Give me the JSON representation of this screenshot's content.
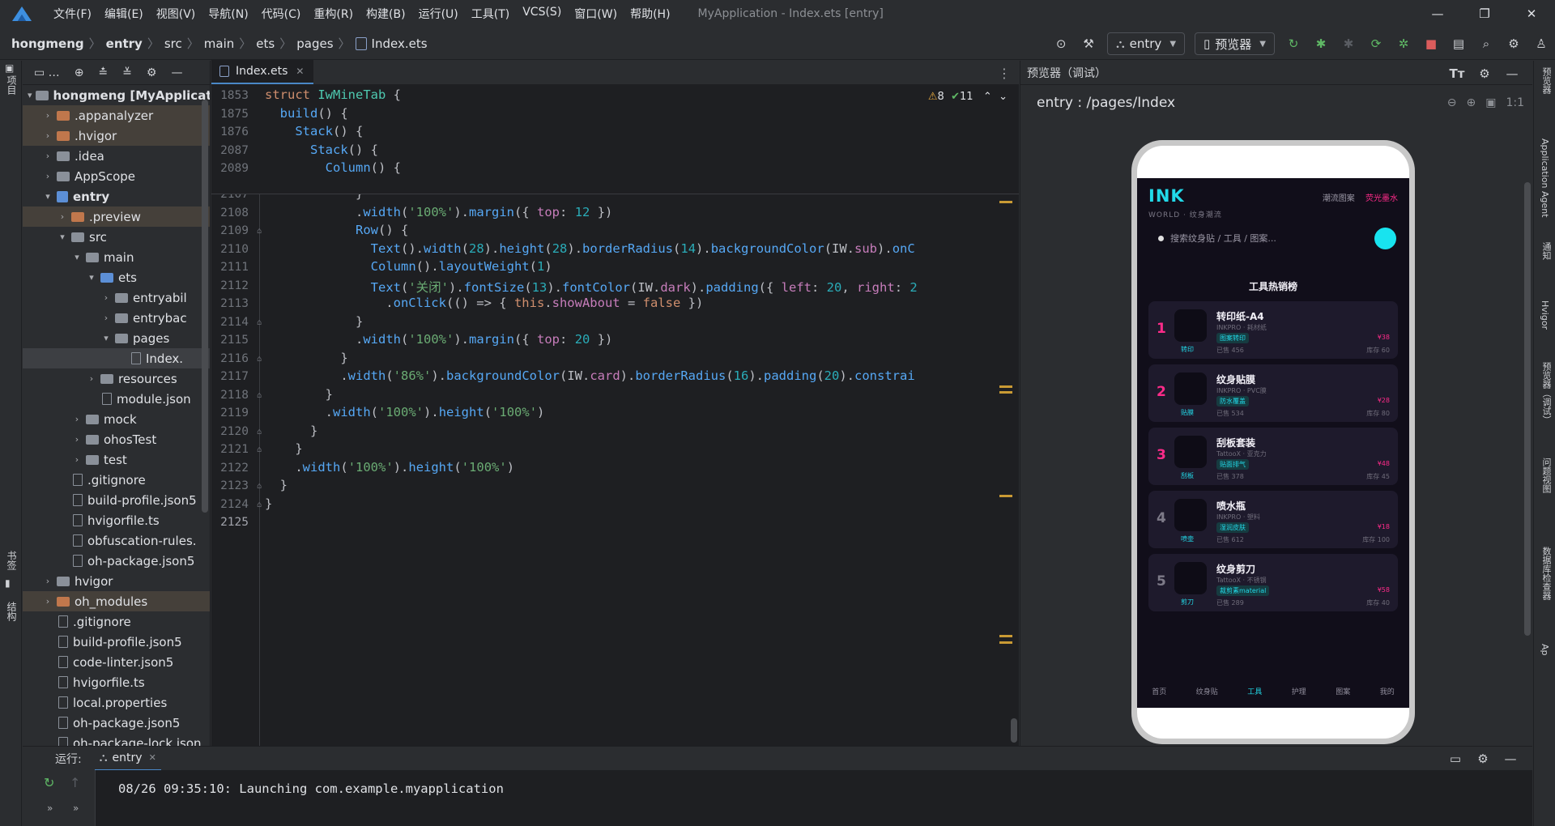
{
  "app": {
    "window_title": "MyApplication - Index.ets [entry]",
    "menu": [
      "文件(F)",
      "编辑(E)",
      "视图(V)",
      "导航(N)",
      "代码(C)",
      "重构(R)",
      "构建(B)",
      "运行(U)",
      "工具(T)",
      "VCS(S)",
      "窗口(W)",
      "帮助(H)"
    ]
  },
  "breadcrumb": [
    "hongmeng",
    "entry",
    "src",
    "main",
    "ets",
    "pages",
    "Index.ets"
  ],
  "toolbar": {
    "run_config": "entry",
    "previewer": "预览器"
  },
  "left_strip": {
    "project": "项目",
    "bookmarks": "书签",
    "structure": "结构"
  },
  "project_tree": [
    {
      "label": "hongmeng [MyApplicati",
      "indent": 0,
      "arrow": "▾",
      "icon": "folder",
      "bold": true
    },
    {
      "label": ".appanalyzer",
      "indent": 1,
      "arrow": "›",
      "icon": "orange",
      "sel": true
    },
    {
      "label": ".hvigor",
      "indent": 1,
      "arrow": "›",
      "icon": "orange",
      "sel": true
    },
    {
      "label": ".idea",
      "indent": 1,
      "arrow": "›",
      "icon": "folder"
    },
    {
      "label": "AppScope",
      "indent": 1,
      "arrow": "›",
      "icon": "folder"
    },
    {
      "label": "entry",
      "indent": 1,
      "arrow": "▾",
      "icon": "mod",
      "bold": true
    },
    {
      "label": ".preview",
      "indent": 2,
      "arrow": "›",
      "icon": "orange",
      "sel": true
    },
    {
      "label": "src",
      "indent": 2,
      "arrow": "▾",
      "icon": "folder"
    },
    {
      "label": "main",
      "indent": 3,
      "arrow": "▾",
      "icon": "folder"
    },
    {
      "label": "ets",
      "indent": 4,
      "arrow": "▾",
      "icon": "blue"
    },
    {
      "label": "entryabil",
      "indent": 5,
      "arrow": "›",
      "icon": "folder"
    },
    {
      "label": "entrybac",
      "indent": 5,
      "arrow": "›",
      "icon": "folder"
    },
    {
      "label": "pages",
      "indent": 5,
      "arrow": "▾",
      "icon": "folder"
    },
    {
      "label": "Index.",
      "indent": 6,
      "arrow": "",
      "icon": "file",
      "hl": true
    },
    {
      "label": "resources",
      "indent": 4,
      "arrow": "›",
      "icon": "folder"
    },
    {
      "label": "module.json",
      "indent": 4,
      "arrow": "",
      "icon": "file"
    },
    {
      "label": "mock",
      "indent": 3,
      "arrow": "›",
      "icon": "folder"
    },
    {
      "label": "ohosTest",
      "indent": 3,
      "arrow": "›",
      "icon": "folder"
    },
    {
      "label": "test",
      "indent": 3,
      "arrow": "›",
      "icon": "folder"
    },
    {
      "label": ".gitignore",
      "indent": 2,
      "arrow": "",
      "icon": "file"
    },
    {
      "label": "build-profile.json5",
      "indent": 2,
      "arrow": "",
      "icon": "file"
    },
    {
      "label": "hvigorfile.ts",
      "indent": 2,
      "arrow": "",
      "icon": "file"
    },
    {
      "label": "obfuscation-rules.",
      "indent": 2,
      "arrow": "",
      "icon": "file"
    },
    {
      "label": "oh-package.json5",
      "indent": 2,
      "arrow": "",
      "icon": "file"
    },
    {
      "label": "hvigor",
      "indent": 1,
      "arrow": "›",
      "icon": "folder"
    },
    {
      "label": "oh_modules",
      "indent": 1,
      "arrow": "›",
      "icon": "orange",
      "sel": true
    },
    {
      "label": ".gitignore",
      "indent": 1,
      "arrow": "",
      "icon": "file"
    },
    {
      "label": "build-profile.json5",
      "indent": 1,
      "arrow": "",
      "icon": "file"
    },
    {
      "label": "code-linter.json5",
      "indent": 1,
      "arrow": "",
      "icon": "file"
    },
    {
      "label": "hvigorfile.ts",
      "indent": 1,
      "arrow": "",
      "icon": "file"
    },
    {
      "label": "local.properties",
      "indent": 1,
      "arrow": "",
      "icon": "file"
    },
    {
      "label": "oh-package.json5",
      "indent": 1,
      "arrow": "",
      "icon": "file"
    },
    {
      "label": "oh-package-lock.json",
      "indent": 1,
      "arrow": "",
      "icon": "file"
    }
  ],
  "editor": {
    "tab": "Index.ets",
    "inspections": {
      "warnings": "8",
      "weak": "11"
    },
    "sticky": [
      {
        "ln": "1853",
        "html": "<span class=\"kw\">struct</span> <span class=\"ty\">IwMineTab</span> {"
      },
      {
        "ln": "1875",
        "html": "  <span class=\"fn\">build</span>() {"
      },
      {
        "ln": "1876",
        "html": "    <span class=\"fn\">Stack</span>() {"
      },
      {
        "ln": "2087",
        "html": "      <span class=\"fn\">Stack</span>() {"
      },
      {
        "ln": "2089",
        "html": "        <span class=\"fn\">Column</span>() {"
      }
    ],
    "lines": [
      {
        "ln": "2107",
        "html": "            }"
      },
      {
        "ln": "2108",
        "html": "            .<span class=\"fn\">width</span>(<span class=\"st\">'100%'</span>).<span class=\"fn\">margin</span>({ <span class=\"pr\">top</span>: <span class=\"nm\">12</span> })"
      },
      {
        "ln": "2109",
        "html": "            <span class=\"fn\">Row</span>() {"
      },
      {
        "ln": "2110",
        "html": "              <span class=\"fn\">Text</span>().<span class=\"fn\">width</span>(<span class=\"nm\">28</span>).<span class=\"fn\">height</span>(<span class=\"nm\">28</span>).<span class=\"fn\">borderRadius</span>(<span class=\"nm\">14</span>).<span class=\"fn\">backgroundColor</span>(IW.<span class=\"pr\">sub</span>).<span class=\"fn\">onC</span>"
      },
      {
        "ln": "2111",
        "html": "              <span class=\"fn\">Column</span>().<span class=\"fn\">layoutWeight</span>(<span class=\"nm\">1</span>)"
      },
      {
        "ln": "2112",
        "html": "              <span class=\"fn\">Text</span>(<span class=\"st\">'关闭'</span>).<span class=\"fn\">fontSize</span>(<span class=\"nm\">13</span>).<span class=\"fn\">fontColor</span>(IW.<span class=\"pr\">dark</span>).<span class=\"fn\">padding</span>({ <span class=\"pr\">left</span>: <span class=\"nm\">20</span>, <span class=\"pr\">right</span>: <span class=\"nm\">2</span>"
      },
      {
        "ln": "2113",
        "html": "                .<span class=\"fn\">onClick</span>(() => { <span class=\"kw\">this</span>.<span class=\"pr\">showAbout</span> = <span class=\"kw\">false</span> })"
      },
      {
        "ln": "2114",
        "html": "            }"
      },
      {
        "ln": "2115",
        "html": "            .<span class=\"fn\">width</span>(<span class=\"st\">'100%'</span>).<span class=\"fn\">margin</span>({ <span class=\"pr\">top</span>: <span class=\"nm\">20</span> })"
      },
      {
        "ln": "2116",
        "html": "          }"
      },
      {
        "ln": "2117",
        "html": "          .<span class=\"fn\">width</span>(<span class=\"st\">'86%'</span>).<span class=\"fn\">backgroundColor</span>(IW.<span class=\"pr\">card</span>).<span class=\"fn\">borderRadius</span>(<span class=\"nm\">16</span>).<span class=\"fn\">padding</span>(<span class=\"nm\">20</span>).<span class=\"fn\">constrai</span>"
      },
      {
        "ln": "2118",
        "html": "        }"
      },
      {
        "ln": "2119",
        "html": "        .<span class=\"fn\">width</span>(<span class=\"st\">'100%'</span>).<span class=\"fn\">height</span>(<span class=\"st\">'100%'</span>)"
      },
      {
        "ln": "2120",
        "html": "      }"
      },
      {
        "ln": "2121",
        "html": "    }"
      },
      {
        "ln": "2122",
        "html": "    .<span class=\"fn\">width</span>(<span class=\"st\">'100%'</span>).<span class=\"fn\">height</span>(<span class=\"st\">'100%'</span>)"
      },
      {
        "ln": "2123",
        "html": "  }"
      },
      {
        "ln": "2124",
        "html": "}"
      },
      {
        "ln": "2125",
        "html": ""
      }
    ]
  },
  "preview": {
    "title": "预览器（调试）",
    "route": "entry : /pages/Index",
    "zoom_ratio": "1:1",
    "app": {
      "brand": "INK",
      "world": "WORLD · 纹身潮流",
      "top_link": "潮流图案",
      "top_pink": "荧光墨水",
      "search_placeholder": "搜索纹身贴 / 工具 / 图案...",
      "section_title": "工具热销榜",
      "rank_colors": [
        "#ff2b8a",
        "#ff2b8a",
        "#ff2b8a",
        "#7d7a88",
        "#7d7a88"
      ],
      "items": [
        {
          "rank": "1",
          "name": "转印纸-A4",
          "sub": "INKPRO · 耗材纸",
          "tag": "图案转印",
          "thumb_label": "转印",
          "sold": "已售 456",
          "price": "¥38",
          "stock": "库存 60"
        },
        {
          "rank": "2",
          "name": "纹身贴膜",
          "sub": "INKPRO · PVC膜",
          "tag": "防水覆盖",
          "thumb_label": "贴膜",
          "sold": "已售 534",
          "price": "¥28",
          "stock": "库存 80"
        },
        {
          "rank": "3",
          "name": "刮板套装",
          "sub": "TattooX · 亚克力",
          "tag": "贴面排气",
          "thumb_label": "刮板",
          "sold": "已售 378",
          "price": "¥48",
          "stock": "库存 45"
        },
        {
          "rank": "4",
          "name": "喷水瓶",
          "sub": "INKPRO · 塑料",
          "tag": "湿润皮肤",
          "thumb_label": "喷壶",
          "sold": "已售 612",
          "price": "¥18",
          "stock": "库存 100"
        },
        {
          "rank": "5",
          "name": "纹身剪刀",
          "sub": "TattooX · 不锈钢",
          "tag": "裁剪素material",
          "thumb_label": "剪刀",
          "sold": "已售 289",
          "price": "¥58",
          "stock": "库存 40"
        }
      ],
      "tabbar": [
        "首页",
        "纹身贴",
        "工具",
        "护理",
        "图案",
        "我的"
      ]
    }
  },
  "right_strip": [
    "预览器",
    "Application Agent",
    "通知",
    "Hvigor",
    "预览器（调试）",
    "问题视图",
    "数据库检查器",
    "Ap"
  ],
  "run": {
    "label": "运行:",
    "tab": "entry",
    "console": "08/26 09:35:10: Launching com.example.myapplication"
  }
}
